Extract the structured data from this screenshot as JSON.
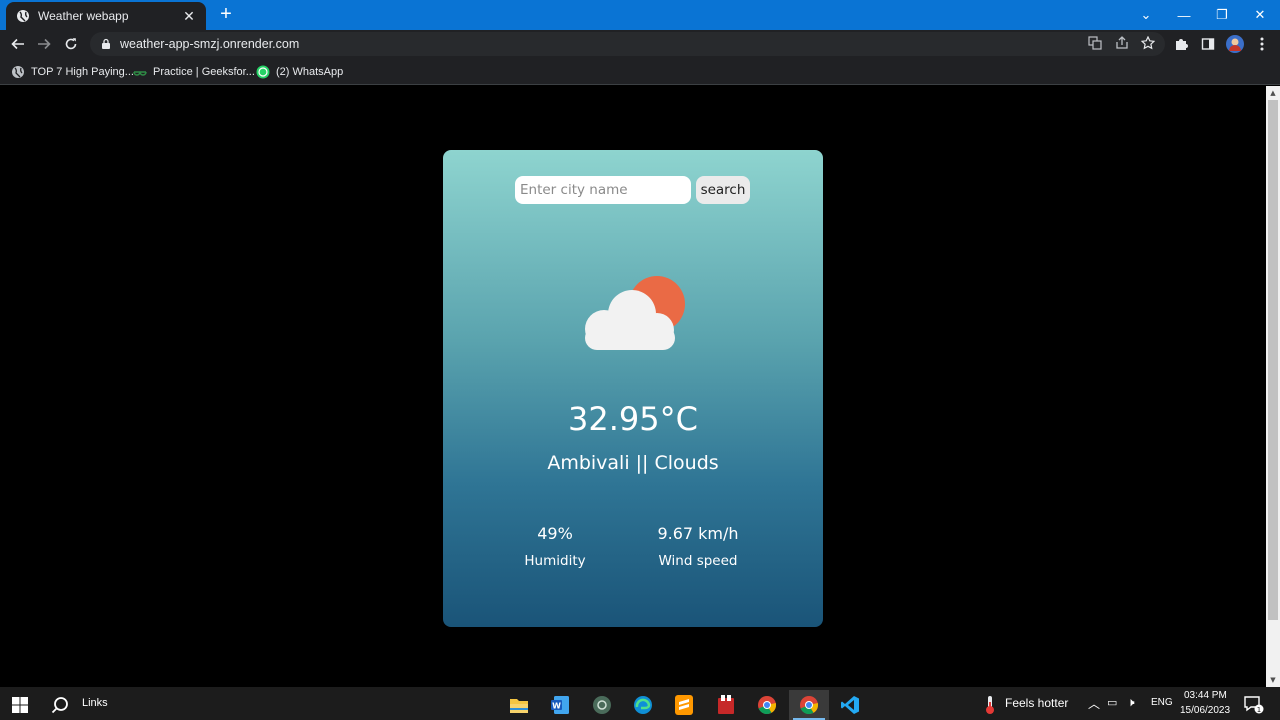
{
  "browser": {
    "tab_title": "Weather webapp",
    "new_tab_symbol": "+",
    "url": "weather-app-smzj.onrender.com",
    "bookmarks": [
      {
        "label": "TOP 7 High Paying...",
        "icon": "globe-icon"
      },
      {
        "label": "Practice | Geeksfor...",
        "icon": "geeksforgeeks-icon"
      },
      {
        "label": "(2) WhatsApp",
        "icon": "whatsapp-icon"
      }
    ]
  },
  "app": {
    "search_placeholder": "Enter city name",
    "search_value": "",
    "search_button": "search",
    "weather_icon": "cloud-sun-icon",
    "temperature": "32.95°C",
    "location_condition": "Ambivali || Clouds",
    "humidity_value": "49%",
    "humidity_label": "Humidity",
    "wind_value": "9.67 km/h",
    "wind_label": "Wind speed",
    "colors": {
      "card_top": "#8ed4cf",
      "card_bottom": "#1a5478",
      "sun": "#ea6a45",
      "cloud": "#f2f2f2"
    }
  },
  "taskbar": {
    "search_label": "Links",
    "weather_widget": "Feels hotter",
    "language": "ENG",
    "time": "03:44 PM",
    "date": "15/06/2023",
    "notification_count": "1",
    "apps": [
      "file-explorer-icon",
      "word-icon",
      "app-icon",
      "edge-icon",
      "sublime-icon",
      "app-icon",
      "chrome-icon",
      "chrome-icon",
      "vscode-icon"
    ]
  }
}
